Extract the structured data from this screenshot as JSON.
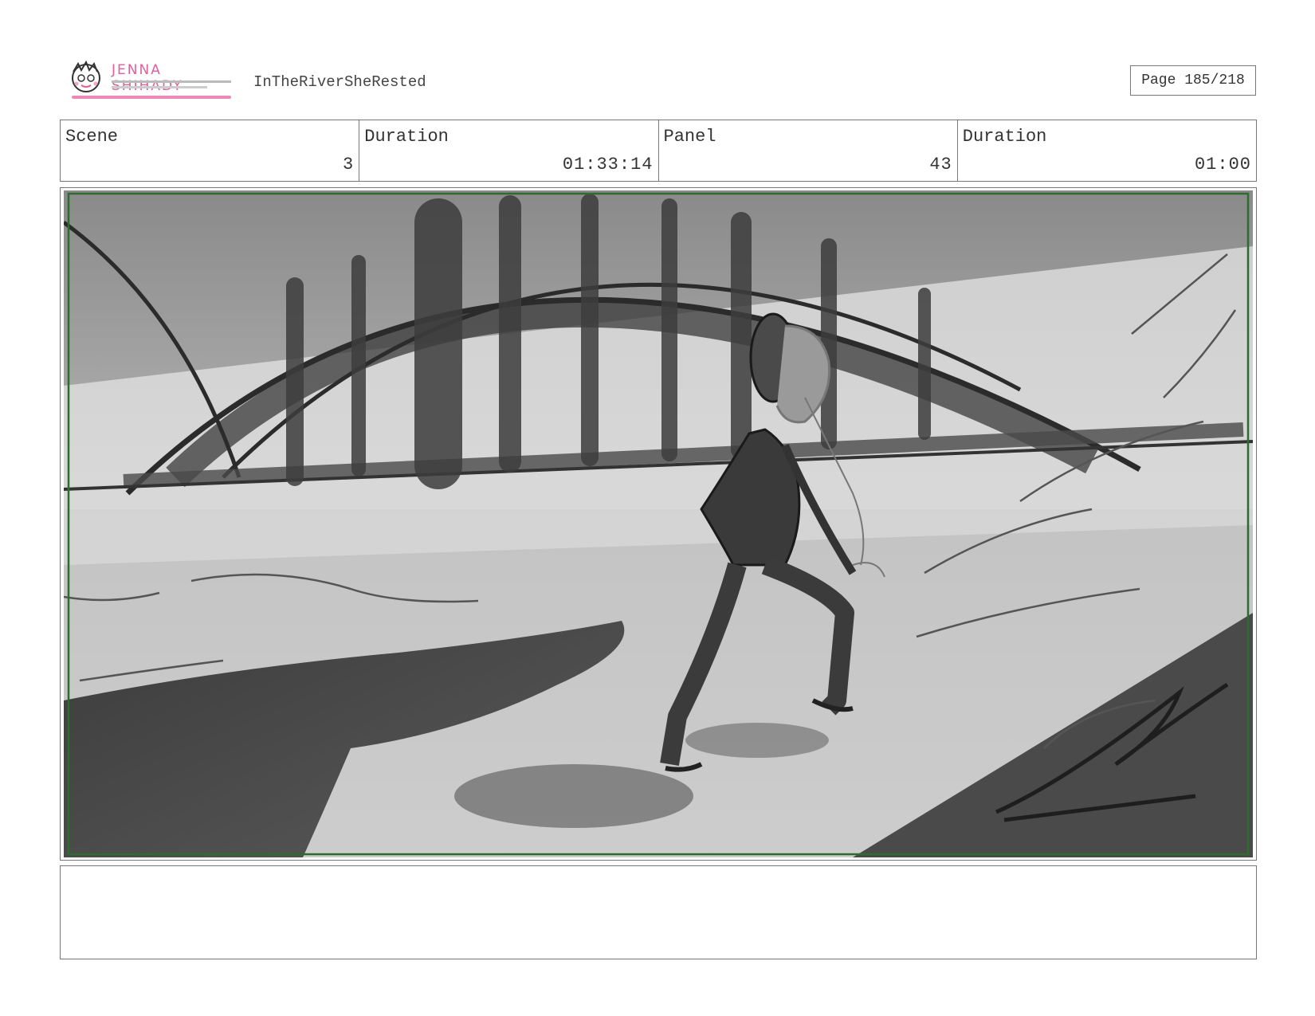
{
  "header": {
    "logo": {
      "name": "JENNA SHIHADY"
    },
    "project_title": "InTheRiverSheRested",
    "page_label": "Page 185/218"
  },
  "info": {
    "scene_label": "Scene",
    "scene_value": "3",
    "scene_duration_label": "Duration",
    "scene_duration_value": "01:33:14",
    "panel_label": "Panel",
    "panel_value": "43",
    "panel_duration_label": "Duration",
    "panel_duration_value": "01:00"
  },
  "panel": {
    "frame_color": "#2e6b2e"
  },
  "notes": {
    "text": ""
  }
}
